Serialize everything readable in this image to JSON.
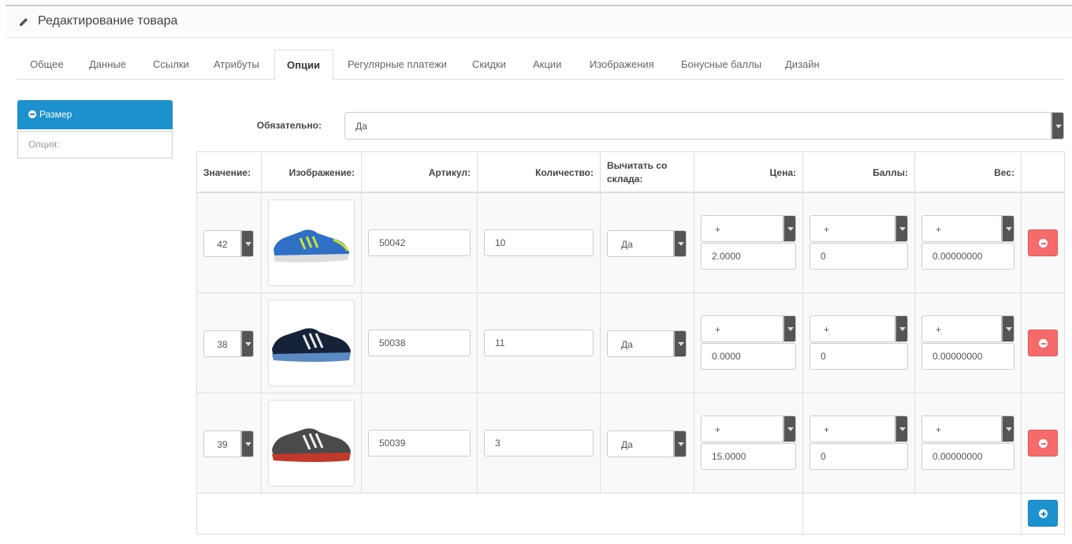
{
  "header": {
    "title": "Редактирование товара",
    "icon": "pencil-icon"
  },
  "tabs": [
    {
      "label": "Общее"
    },
    {
      "label": "Данные"
    },
    {
      "label": "Ссылки"
    },
    {
      "label": "Атрибуты"
    },
    {
      "label": "Опции",
      "active": true
    },
    {
      "label": "Регулярные платежи"
    },
    {
      "label": "Скидки"
    },
    {
      "label": "Акции"
    },
    {
      "label": "Изображения"
    },
    {
      "label": "Бонусные баллы"
    },
    {
      "label": "Дизайн"
    }
  ],
  "options_list": {
    "active_option": "Размер",
    "add_placeholder": "Опция:"
  },
  "required": {
    "label": "Обязательно:",
    "value": "Да"
  },
  "table": {
    "headers": {
      "value": "Значение:",
      "image": "Изображение:",
      "sku": "Артикул:",
      "quantity": "Количество:",
      "subtract": "Вычитать со склада:",
      "price": "Цена:",
      "points": "Баллы:",
      "weight": "Вес:"
    },
    "rows": [
      {
        "value": "42",
        "image": "sneaker-blue",
        "sku": "50042",
        "quantity": "10",
        "subtract": "Да",
        "price_prefix": "+",
        "price": "2.0000",
        "points_prefix": "+",
        "points": "0",
        "weight_prefix": "+",
        "weight": "0.00000000"
      },
      {
        "value": "38",
        "image": "sneaker-navy",
        "sku": "50038",
        "quantity": "11",
        "subtract": "Да",
        "price_prefix": "+",
        "price": "0.0000",
        "points_prefix": "+",
        "points": "0",
        "weight_prefix": "+",
        "weight": "0.00000000"
      },
      {
        "value": "39",
        "image": "sneaker-grey-red",
        "sku": "50039",
        "quantity": "3",
        "subtract": "Да",
        "price_prefix": "+",
        "price": "15.0000",
        "points_prefix": "+",
        "points": "0",
        "weight_prefix": "+",
        "weight": "0.00000000"
      }
    ]
  },
  "colors": {
    "primary": "#1e91cf",
    "danger": "#f56b6b"
  }
}
